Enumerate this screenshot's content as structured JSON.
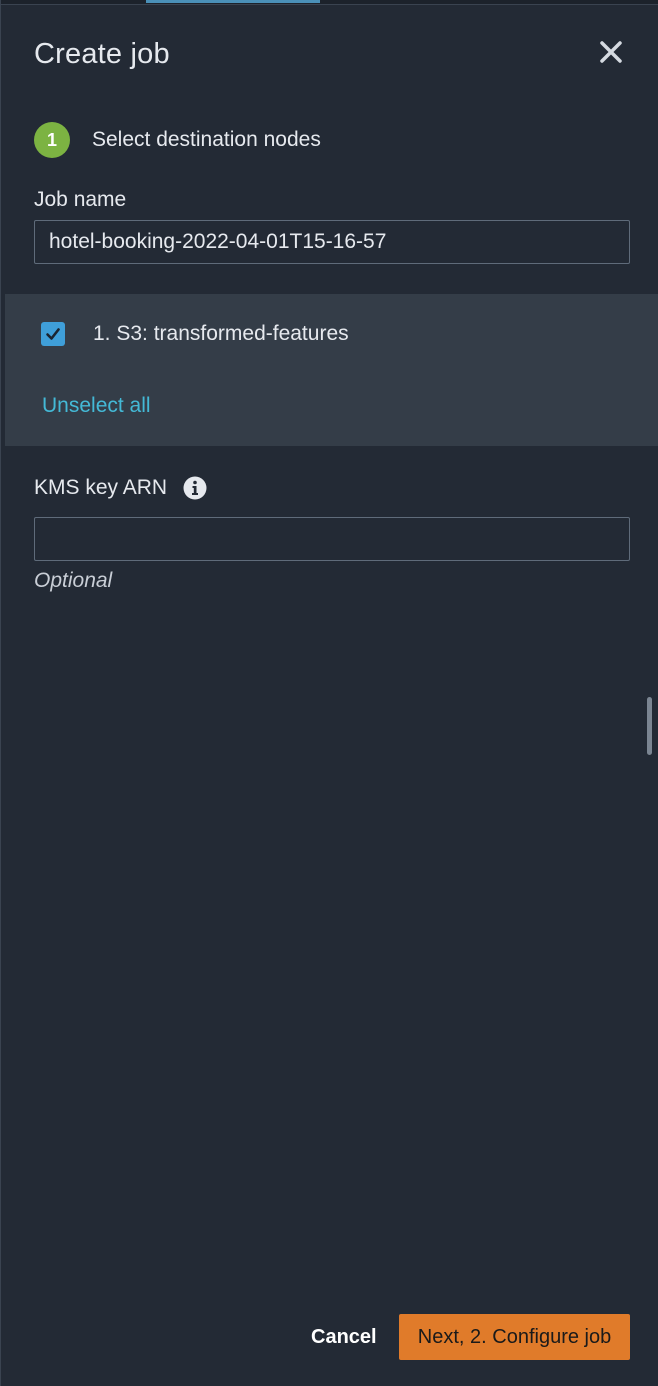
{
  "dialog": {
    "title": "Create job",
    "close_icon": "close-icon"
  },
  "step": {
    "number": "1",
    "label": "Select destination nodes",
    "color": "#7cb342"
  },
  "job_name": {
    "label": "Job name",
    "value": "hotel-booking-2022-04-01T15-16-57"
  },
  "nodes": {
    "items": [
      {
        "label": "1. S3: transformed-features",
        "checked": true
      }
    ],
    "unselect_all_label": "Unselect all",
    "checkbox_color": "#3f9fd9",
    "link_color": "#44b9d6"
  },
  "kms": {
    "label": "KMS key ARN",
    "info_icon": "info-icon",
    "value": "",
    "hint": "Optional"
  },
  "footer": {
    "cancel_label": "Cancel",
    "next_label": "Next, 2. Configure job",
    "primary_color": "#e07b2a"
  }
}
